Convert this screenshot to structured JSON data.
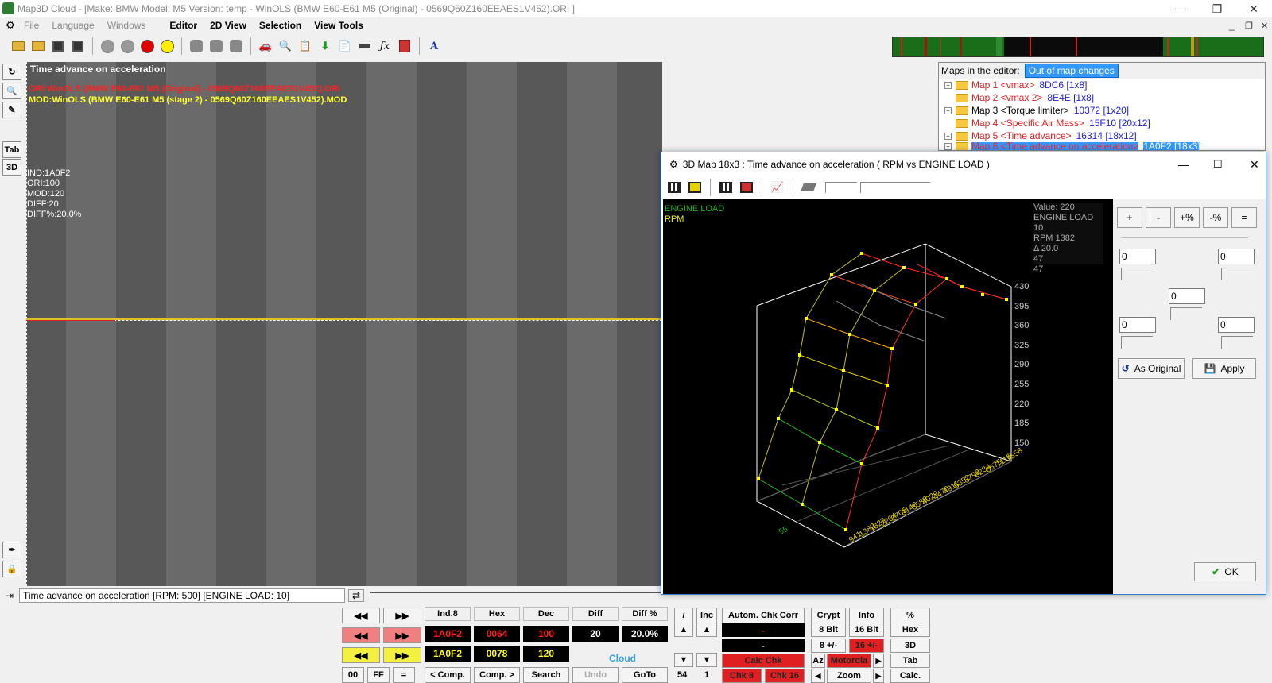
{
  "window": {
    "title": "Map3D Cloud - [Make: BMW Model: M5  Version: temp - WinOLS (BMW E60-E61 M5 (Original) - 0569Q60Z160EEAES1V452).ORI ]",
    "min": "—",
    "max": "❐",
    "close": "✕"
  },
  "menu": {
    "file": "File",
    "language": "Language",
    "windows": "Windows",
    "editor": "Editor",
    "view2d": "2D View",
    "selection": "Selection",
    "viewtools": "View Tools"
  },
  "left_tools": {
    "tab": "Tab",
    "view3d": "3D"
  },
  "plot": {
    "title": "Time advance on acceleration",
    "ori": "ORI:WinOLS (BMW E60-E61 M5 (Original) - 0569Q60Z160EEAES1V452).ORI",
    "mod": "MOD:WinOLS (BMW E60-E61 M5 (stage 2) - 0569Q60Z160EEAES1V452).MOD",
    "info": {
      "ind": "IND:1A0F2",
      "ori": "ORI:100",
      "mod": "MOD:120",
      "diff": "DIFF:20",
      "diffp": "DIFF%:20.0%"
    }
  },
  "status": "Time advance on acceleration [RPM: 500] [ENGINE LOAD: 10]",
  "maps_panel": {
    "label": "Maps in the editor:",
    "tab": "Out of map changes",
    "items": [
      {
        "exp": "+",
        "a": "Map 1 <vmax>",
        "b": "8DC6 [1x8]"
      },
      {
        "exp": "",
        "a": "Map 2 <vmax 2>",
        "b": "8E4E [1x8]"
      },
      {
        "exp": "+",
        "a": "Map 3 <Torque limiter>",
        "b": "10372 [1x20]"
      },
      {
        "exp": "",
        "a": "Map 4 <Specific Air Mass>",
        "b": "15F10 [20x12]"
      },
      {
        "exp": "+",
        "a": "Map 5 <Time advance>",
        "b": "16314 [18x12]"
      },
      {
        "exp": "+",
        "a": "Map 6 <Time advance on acceleration>",
        "b": "1A0F2 [18x3]"
      }
    ]
  },
  "dialog": {
    "title": "3D Map 18x3 :  Time advance on acceleration ( RPM vs ENGINE LOAD )",
    "legend_load": "ENGINE LOAD",
    "legend_rpm": "RPM",
    "readout": {
      "value": "Value: 220",
      "load": "ENGINE LOAD 10",
      "rpm": "RPM 1382",
      "delta": "Δ 20.0",
      "a": "47",
      "b": "47"
    },
    "z_ticks": [
      "430",
      "395",
      "360",
      "325",
      "290",
      "255",
      "220",
      "185",
      "150"
    ],
    "rpm_ticks": [
      "941",
      "1382",
      "1823",
      "2264",
      "2705",
      "3146",
      "3588",
      "4029",
      "4470",
      "4911",
      "5352",
      "5793",
      "6234",
      "6675",
      "7116",
      "7558"
    ],
    "load_tick": "55",
    "ops": {
      "plus": "+",
      "minus": "-",
      "pplus": "+%",
      "pminus": "-%",
      "eq": "="
    },
    "inputs": {
      "tl": "0",
      "tr": "0",
      "mid": "0",
      "bl": "0",
      "br": "0"
    },
    "as_original": "As Original",
    "apply": "Apply",
    "ok": "OK"
  },
  "bottom": {
    "nav_left": "◀◀",
    "nav_right": "▶▶",
    "h_ind": "Ind.8",
    "h_hex": "Hex",
    "h_dec": "Dec",
    "h_diff": "Diff",
    "h_diffp": "Diff %",
    "ori_ind": "1A0F2",
    "ori_hex": "0064",
    "ori_dec": "100",
    "diff": "20",
    "diffp": "20.0%",
    "mod_ind": "1A0F2",
    "mod_hex": "0078",
    "mod_dec": "120",
    "cloud": "Cloud",
    "b00": "00",
    "bff": "FF",
    "beq": "=",
    "comp_l": "< Comp.",
    "comp_r": "Comp. >",
    "search": "Search",
    "undo": "Undo",
    "goto": "GoTo",
    "slash": "/",
    "inc": "Inc",
    "step": "54",
    "one": "1",
    "auto": "Autom. Chk Corr",
    "crypt": "Crypt",
    "info": "Info",
    "pct": "%",
    "bit8": "8 Bit",
    "bit16": "16 Bit",
    "hex": "Hex",
    "pm8": "8 +/-",
    "pm16": "16 +/-",
    "v3d": "3D",
    "calc_chk": "Calc Chk",
    "az": "Az",
    "motorola": "Motorola",
    "tab": "Tab",
    "chk8": "Chk 8",
    "chk16": "Chk 16",
    "zoom": "Zoom",
    "calc": "Calc.",
    "dash": "-"
  }
}
